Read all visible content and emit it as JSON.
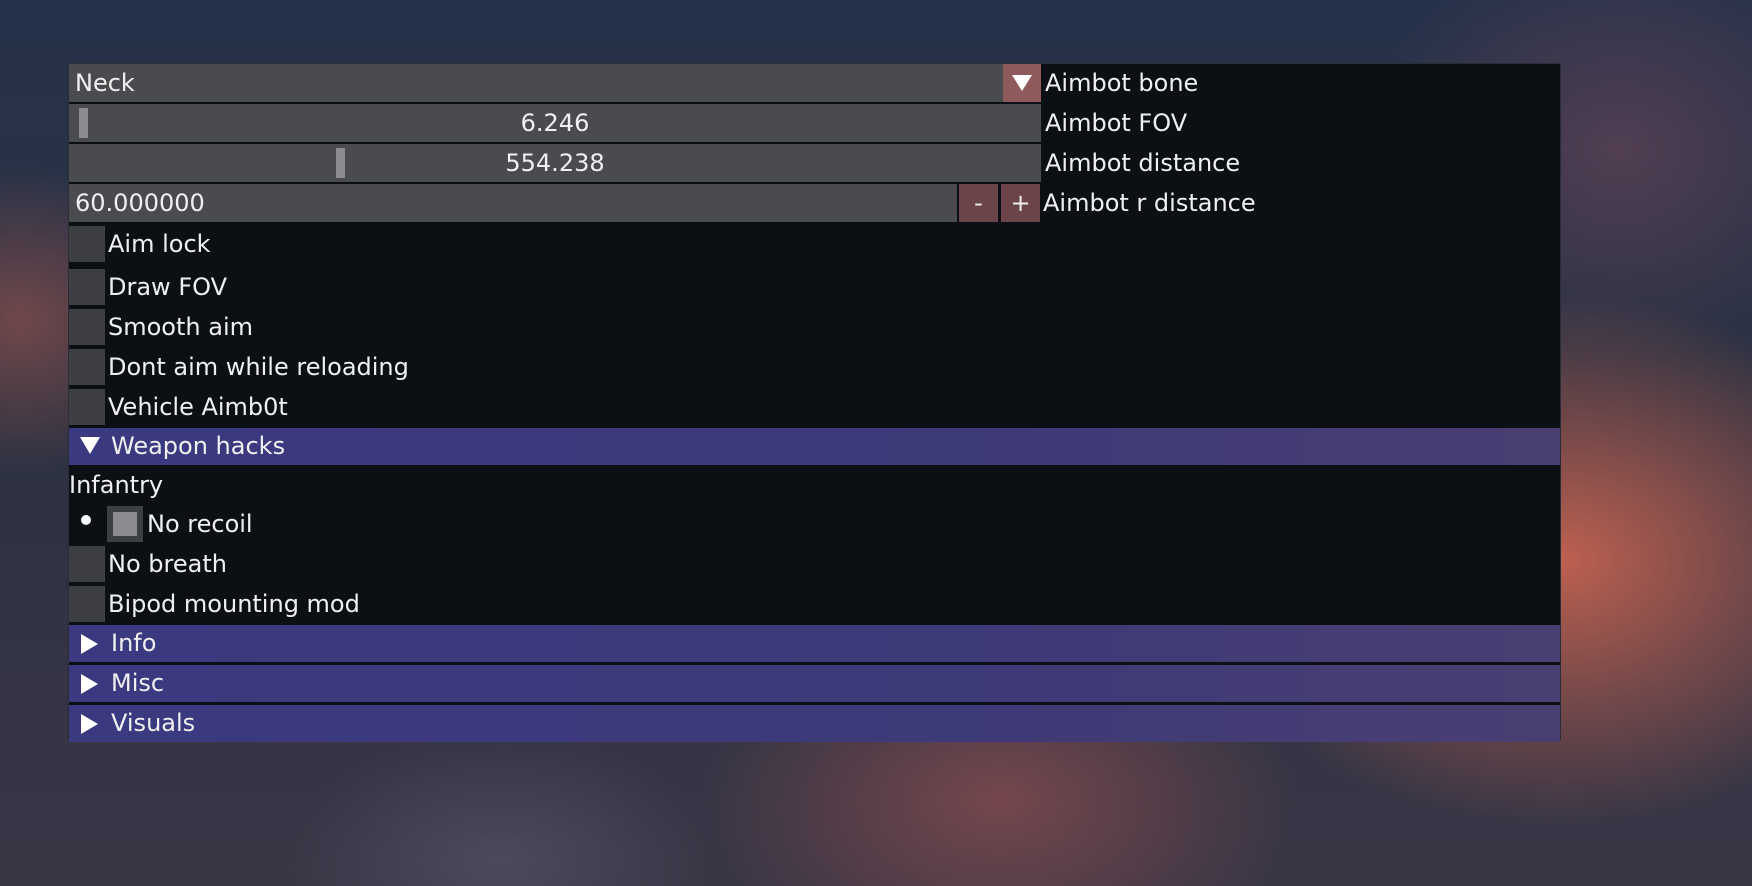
{
  "aimbot": {
    "bone": {
      "value": "Neck",
      "label": "Aimbot bone",
      "arrow_icon": "triangle-down"
    },
    "fov": {
      "value": "6.246",
      "label": "Aimbot FOV",
      "fraction": 0.006
    },
    "distance": {
      "value": "554.238",
      "label": "Aimbot distance",
      "fraction": 0.275
    },
    "r_distance": {
      "value": "60.000000",
      "label": "Aimbot r distance",
      "minus": "-",
      "plus": "+"
    },
    "options": [
      {
        "label": "Aim lock",
        "checked": false
      },
      {
        "label": "Draw FOV",
        "checked": false
      },
      {
        "label": "Smooth aim",
        "checked": false
      },
      {
        "label": "Dont aim while reloading",
        "checked": false
      },
      {
        "label": "Vehicle Aimb0t",
        "checked": false
      }
    ]
  },
  "weapon_hacks": {
    "header": "Weapon hacks",
    "expanded": true,
    "subheading": "Infantry",
    "options": [
      {
        "label": "No recoil",
        "checked": false,
        "hovered": true
      },
      {
        "label": "No breath",
        "checked": false
      },
      {
        "label": "Bipod mounting mod",
        "checked": false
      }
    ]
  },
  "sections": [
    {
      "label": "Info",
      "expanded": false
    },
    {
      "label": "Misc",
      "expanded": false
    },
    {
      "label": "Visuals",
      "expanded": false
    }
  ],
  "colors": {
    "header": "#3b3980",
    "frame": "#4a4b4f",
    "button": "#6b4449",
    "combo_arrow": "#8e5a5c"
  }
}
